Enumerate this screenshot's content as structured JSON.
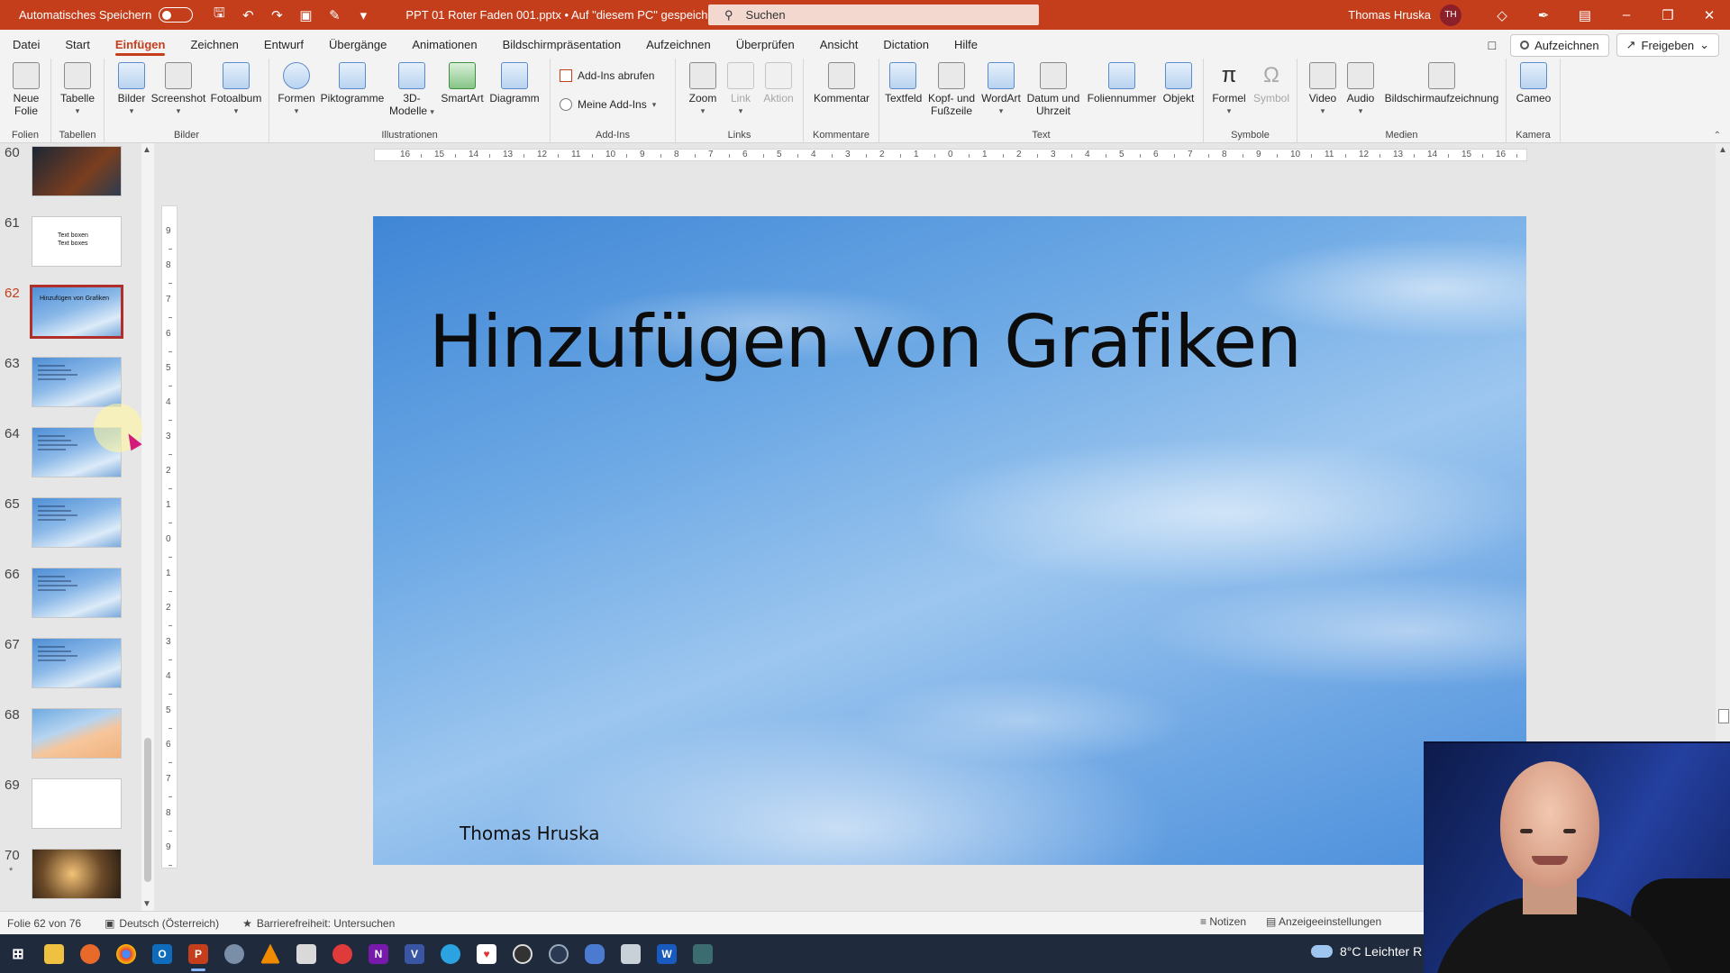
{
  "titlebar": {
    "autosave_label": "Automatisches Speichern",
    "doc_title": "PPT 01 Roter Faden 001.pptx  •  Auf \"diesem PC\" gespeichert",
    "search_placeholder": "Suchen",
    "user_name": "Thomas Hruska",
    "user_initials": "TH",
    "accent_color": "#c43e1c"
  },
  "menu": {
    "tabs": [
      "Datei",
      "Start",
      "Einfügen",
      "Zeichnen",
      "Entwurf",
      "Übergänge",
      "Animationen",
      "Bildschirmpräsentation",
      "Aufzeichnen",
      "Überprüfen",
      "Ansicht",
      "Dictation",
      "Hilfe"
    ],
    "active_tab": "Einfügen",
    "record_label": "Aufzeichnen",
    "share_label": "Freigeben"
  },
  "ribbon": {
    "groups": {
      "folien": "Folien",
      "tabellen": "Tabellen",
      "bilder": "Bilder",
      "illustrationen": "Illustrationen",
      "addins": "Add-Ins",
      "links": "Links",
      "kommentare": "Kommentare",
      "text": "Text",
      "symbole": "Symbole",
      "medien": "Medien",
      "kamera": "Kamera"
    },
    "buttons": {
      "neue_folie_1": "Neue",
      "neue_folie_2": "Folie",
      "tabelle": "Tabelle",
      "bilder": "Bilder",
      "screenshot": "Screenshot",
      "fotoalbum": "Fotoalbum",
      "formen": "Formen",
      "piktogramme": "Piktogramme",
      "modelle_1": "3D-",
      "modelle_2": "Modelle",
      "smartart": "SmartArt",
      "diagramm": "Diagramm",
      "addins_abrufen": "Add-Ins abrufen",
      "meine_addins": "Meine Add-Ins",
      "zoom": "Zoom",
      "link": "Link",
      "aktion": "Aktion",
      "kommentar": "Kommentar",
      "textfeld": "Textfeld",
      "kopf_1": "Kopf- und",
      "kopf_2": "Fußzeile",
      "wordart": "WordArt",
      "datum_1": "Datum und",
      "datum_2": "Uhrzeit",
      "foliennummer": "Foliennummer",
      "objekt": "Objekt",
      "formel": "Formel",
      "symbol": "Symbol",
      "video": "Video",
      "audio": "Audio",
      "bildschirmaufzeichnung": "Bildschirmaufzeichnung",
      "cameo": "Cameo"
    }
  },
  "thumbnails": [
    {
      "num": "60",
      "style": "dark",
      "text": ""
    },
    {
      "num": "61",
      "style": "white",
      "text": "Text boxen\nText boxes"
    },
    {
      "num": "62",
      "style": "sky",
      "text": "Hinzufügen von Grafiken",
      "selected": true
    },
    {
      "num": "63",
      "style": "sky",
      "text": ""
    },
    {
      "num": "64",
      "style": "sky",
      "text": ""
    },
    {
      "num": "65",
      "style": "sky",
      "text": ""
    },
    {
      "num": "66",
      "style": "sky",
      "text": ""
    },
    {
      "num": "67",
      "style": "sky",
      "text": ""
    },
    {
      "num": "68",
      "style": "peach",
      "text": ""
    },
    {
      "num": "69",
      "style": "white",
      "text": ""
    },
    {
      "num": "70",
      "style": "gold",
      "text": "",
      "star": "*"
    }
  ],
  "slide": {
    "title": "Hinzufügen von Grafiken",
    "author": "Thomas Hruska"
  },
  "statusbar": {
    "slide_info": "Folie 62 von 76",
    "language": "Deutsch (Österreich)",
    "accessibility": "Barrierefreiheit: Untersuchen",
    "notes": "Notizen",
    "display_settings": "Anzeigeeinstellungen"
  },
  "taskbar": {
    "weather": "8°C  Leichter R"
  }
}
